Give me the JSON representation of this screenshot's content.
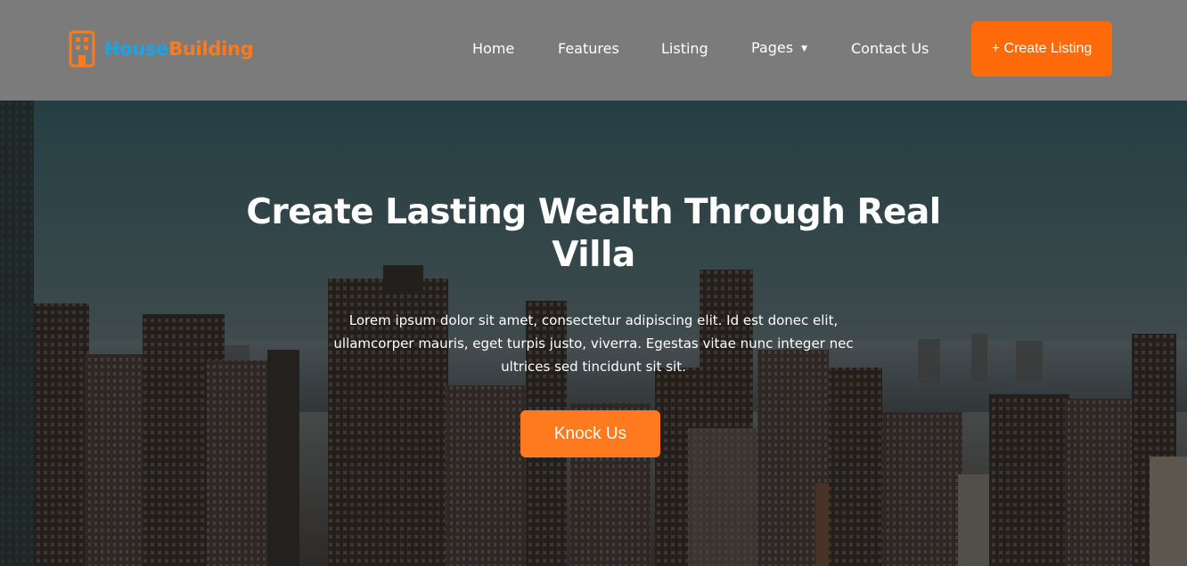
{
  "brand": {
    "name_part1": "House",
    "name_part2": "Building",
    "icon": "building-icon",
    "color_primary": "#1aa3ea",
    "color_accent": "#ff7a1a"
  },
  "nav": {
    "items": [
      {
        "label": "Home"
      },
      {
        "label": "Features"
      },
      {
        "label": "Listing"
      },
      {
        "label": "Pages",
        "has_dropdown": true,
        "dropdown_icon": "caret-down-icon"
      },
      {
        "label": "Contact Us"
      }
    ],
    "cta_label": "+ Create Listing",
    "cta_color": "#ff6b0a"
  },
  "hero": {
    "title": "Create Lasting Wealth Through Real Villa",
    "description": "Lorem ipsum dolor sit amet, consectetur adipiscing elit. Id est donec elit, ullamcorper mauris, eget turpis justo, viverra. Egestas vitae nunc integer nec ultrices sed tincidunt sit sit.",
    "button_label": "Knock Us",
    "button_color": "#ff7a1f",
    "background": "city-skyline-image"
  },
  "colors": {
    "header_bg": "#7b7b7b",
    "text": "#ffffff"
  }
}
